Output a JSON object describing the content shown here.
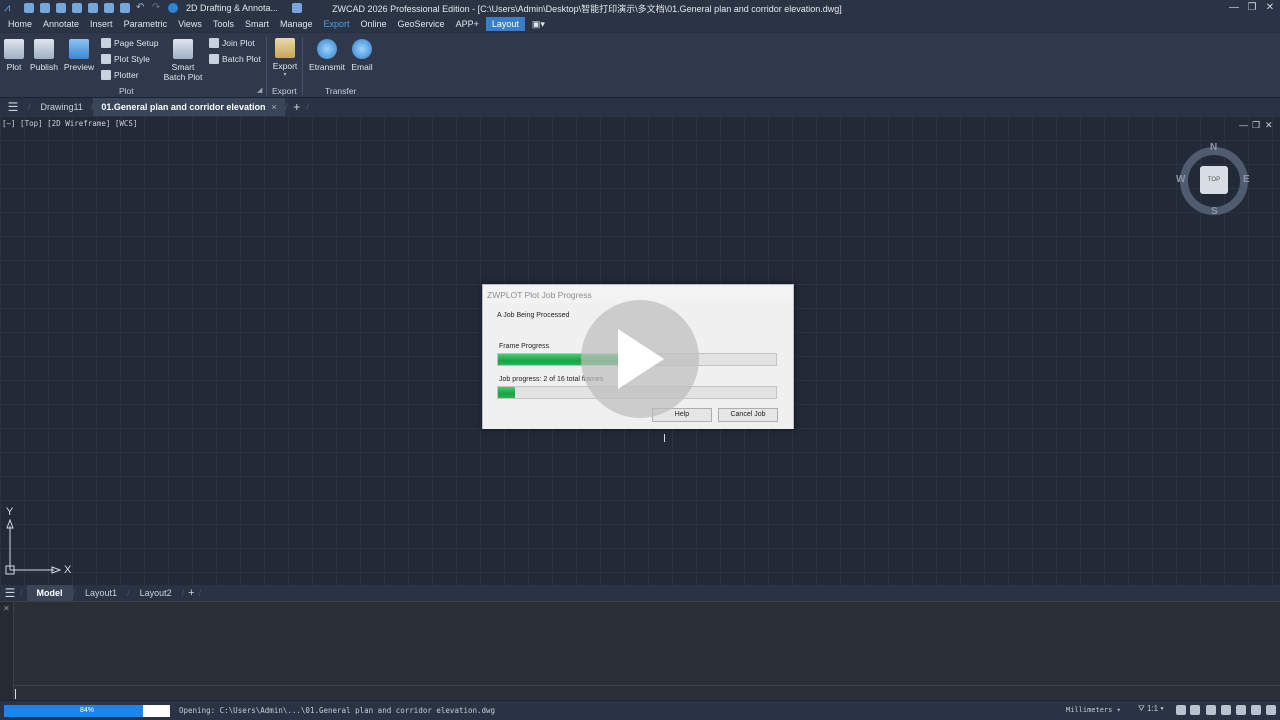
{
  "titlebar": {
    "workspace": "2D Drafting & Annota...",
    "window_title": "ZWCAD 2026 Professional Edition - [C:\\Users\\Admin\\Desktop\\智能打印演示\\多文档\\01.General plan and corridor elevation.dwg]",
    "minimize": "—",
    "maximize": "❐",
    "close": "✕"
  },
  "menu": {
    "items": [
      "Home",
      "Annotate",
      "Insert",
      "Parametric",
      "Views",
      "Tools",
      "Smart",
      "Manage",
      "Export",
      "Online",
      "GeoService",
      "APP+",
      "Layout"
    ],
    "active": "Export"
  },
  "ribbon": {
    "plot": "Plot",
    "publish": "Publish",
    "preview": "Preview",
    "page_setup": "Page Setup",
    "plot_style": "Plot Style",
    "plotter": "Plotter",
    "smart_batch_plot_1": "Smart",
    "smart_batch_plot_2": "Batch Plot",
    "join_plot": "Join Plot",
    "batch_plot": "Batch Plot",
    "export": "Export",
    "etransmit": "Etransmit",
    "email": "Email",
    "group_plot": "Plot",
    "group_export": "Export",
    "group_transfer": "Transfer"
  },
  "doc_tabs": {
    "menu_icon": "hamburger-icon",
    "tabs": [
      "Drawing11",
      "01.General plan and corridor elevation"
    ],
    "active_index": 1,
    "close": "×",
    "add": "+"
  },
  "canvas": {
    "view_label": "[—] [Top] [2D Wireframe] [WCS]",
    "viewcube": {
      "top": "TOP",
      "n": "N",
      "s": "S",
      "e": "E",
      "w": "W"
    },
    "ucs": {
      "x": "X",
      "y": "Y"
    }
  },
  "dialog": {
    "title": "ZWPLOT Plot Job Progress",
    "status": "A Job Being Processed",
    "frame_label": "Frame Progress",
    "frame_progress": 0.43,
    "job_label": "Job progress: 2 of 16 total frames",
    "job_progress": 0.0625,
    "help": "Help",
    "cancel": "Cancel Job"
  },
  "layout_tabs": {
    "tabs": [
      "Model",
      "Layout1",
      "Layout2"
    ],
    "active_index": 0,
    "add": "+"
  },
  "command": {
    "close": "✕"
  },
  "status": {
    "progress_percent": 84,
    "progress_text": "84%",
    "message": "Opening: C:\\Users\\Admin\\...\\01.General plan and corridor elevation.dwg",
    "units": "Millimeters",
    "scale": "1:1"
  }
}
